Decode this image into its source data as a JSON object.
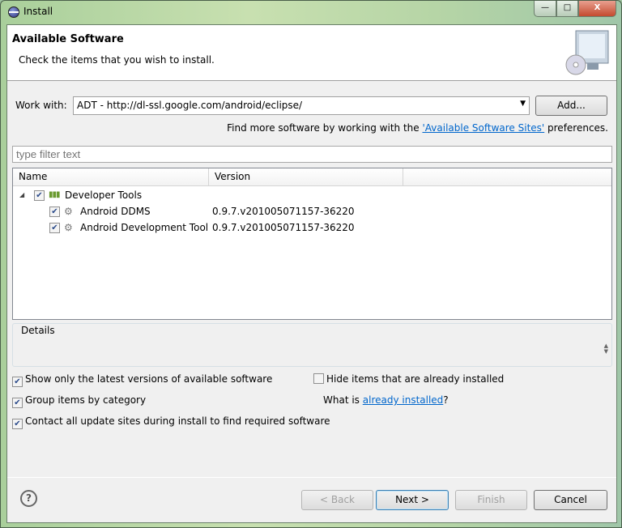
{
  "window": {
    "title": "Install",
    "minimize": "—",
    "maximize": "□",
    "close": "X"
  },
  "header": {
    "title": "Available Software",
    "subtitle": "Check the items that you wish to install."
  },
  "work_with": {
    "label": "Work with:",
    "value": "ADT - http://dl-ssl.google.com/android/eclipse/",
    "add_button": "Add..."
  },
  "find_more": {
    "prefix": "Find more software by working with the ",
    "link": "'Available Software Sites'",
    "suffix": " preferences."
  },
  "filter": {
    "placeholder": "type filter text"
  },
  "table": {
    "columns": [
      "Name",
      "Version"
    ],
    "rows": [
      {
        "name": "Developer Tools",
        "version": "",
        "checked": true,
        "level": 0
      },
      {
        "name": "Android DDMS",
        "version": "0.9.7.v201005071157-36220",
        "checked": true,
        "level": 1
      },
      {
        "name": "Android Development Tool",
        "version": "0.9.7.v201005071157-36220",
        "checked": true,
        "level": 1
      }
    ]
  },
  "details": {
    "label": "Details"
  },
  "options": {
    "latest": "Show only the latest versions of available software",
    "hide_installed": "Hide items that are already installed",
    "group": "Group items by category",
    "what_is_prefix": "What is ",
    "already_installed": "already installed",
    "what_is_suffix": "?",
    "contact": "Contact all update sites during install to find required software"
  },
  "buttons": {
    "back": "< Back",
    "next": "Next >",
    "finish": "Finish",
    "cancel": "Cancel",
    "help": "?"
  }
}
